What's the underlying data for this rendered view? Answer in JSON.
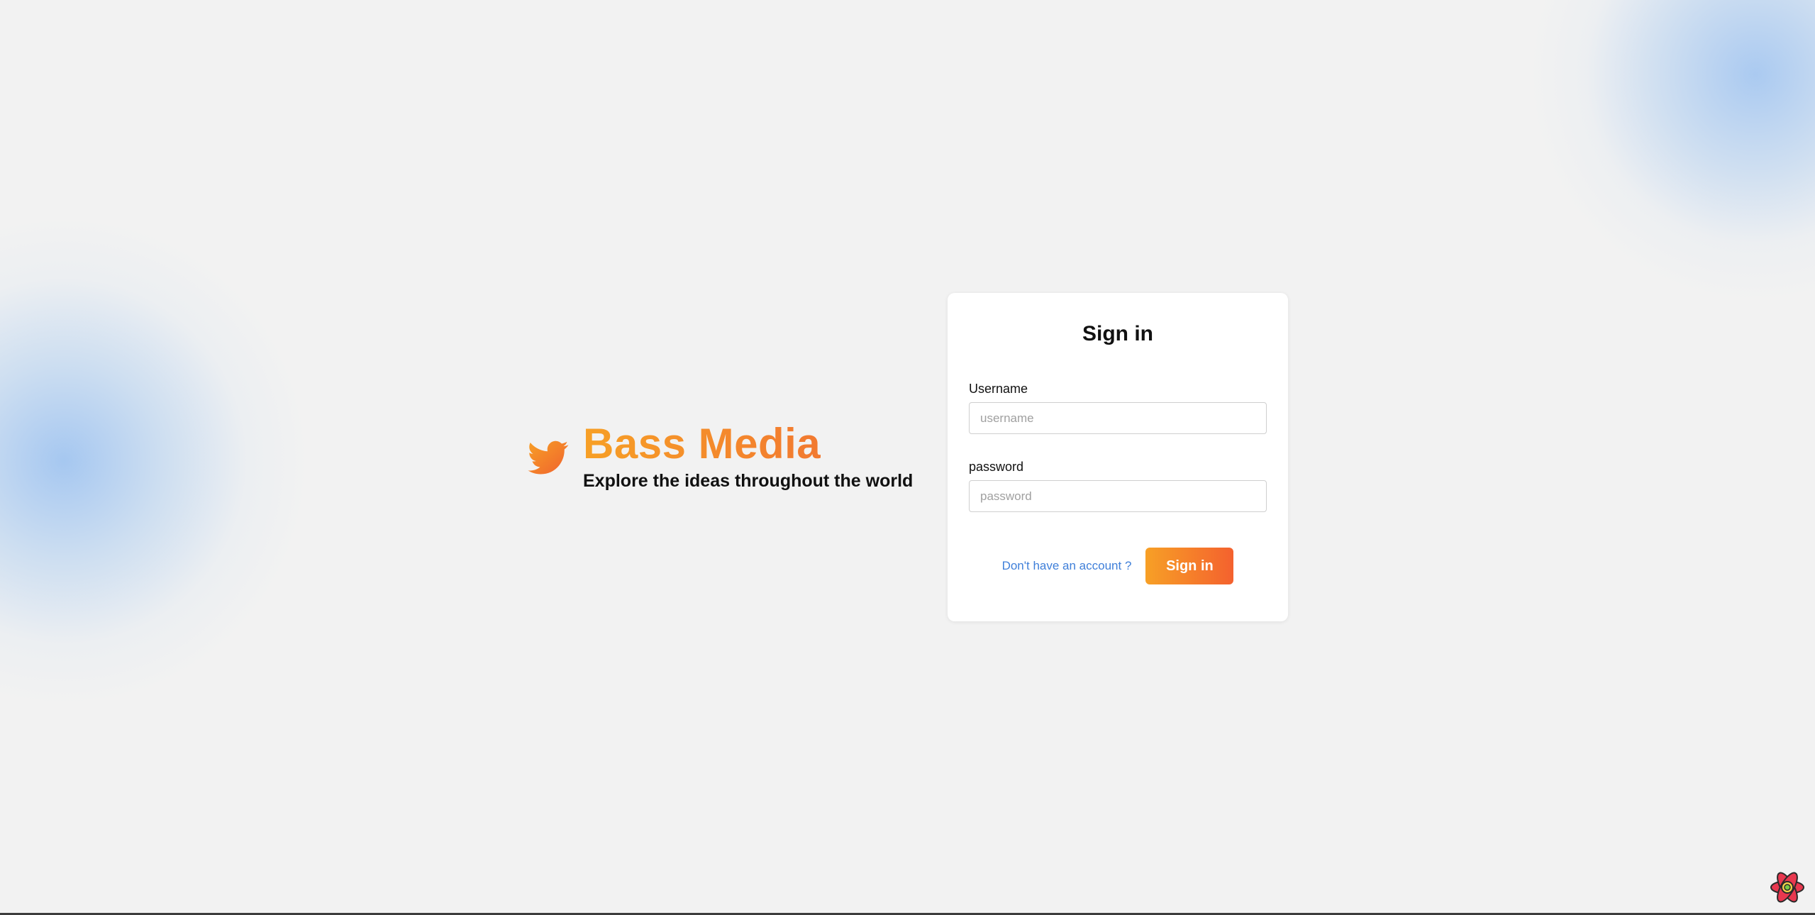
{
  "brand": {
    "name": "Bass Media",
    "tagline": "Explore the ideas throughout the world",
    "logo_icon": "bird-icon",
    "gradient_start": "#f7a026",
    "gradient_end": "#f06a34"
  },
  "signin": {
    "title": "Sign in",
    "username_label": "Username",
    "username_placeholder": "username",
    "username_value": "",
    "password_label": "password",
    "password_placeholder": "password",
    "password_value": "",
    "signup_link": "Don't have an account ?",
    "submit_label": "Sign in"
  },
  "colors": {
    "background": "#f2f2f2",
    "card": "#ffffff",
    "link": "#3f7fd9",
    "accent_blur": "#8cb9f0"
  },
  "devtools": {
    "icon": "react-devtools-icon"
  }
}
